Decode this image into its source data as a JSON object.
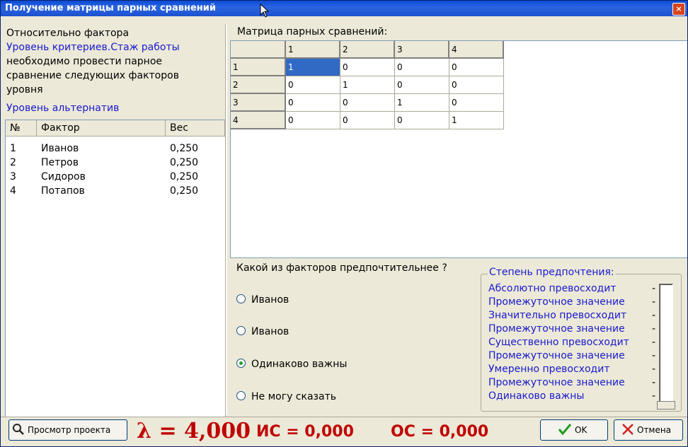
{
  "window": {
    "title": "Получение матрицы парных сравнений",
    "close_icon": "close-icon"
  },
  "left": {
    "relative_label": "Относительно фактора",
    "criteria_line": "Уровень критериев.Стаж работы",
    "instruction_1": "необходимо провести парное",
    "instruction_2": "сравнение следующих факторов",
    "instruction_3": "уровня",
    "alternatives_level": "Уровень альтернатив",
    "columns": [
      "№",
      "Фактор",
      "Вес"
    ],
    "rows": [
      {
        "num": "1",
        "name": "Иванов",
        "weight": "0,250"
      },
      {
        "num": "2",
        "name": "Петров",
        "weight": "0,250"
      },
      {
        "num": "3",
        "name": "Сидоров",
        "weight": "0,250"
      },
      {
        "num": "4",
        "name": "Потапов",
        "weight": "0,250"
      }
    ]
  },
  "matrix": {
    "label": "Матрица парных сравнений:",
    "col_headers": [
      "1",
      "2",
      "3",
      "4"
    ],
    "row_headers": [
      "1",
      "2",
      "3",
      "4"
    ],
    "cells": [
      [
        "1",
        "0",
        "0",
        "0"
      ],
      [
        "0",
        "1",
        "0",
        "0"
      ],
      [
        "0",
        "0",
        "1",
        "0"
      ],
      [
        "0",
        "0",
        "0",
        "1"
      ]
    ],
    "selected_cell": "1,1"
  },
  "question": {
    "text": "Какой из факторов предпочтительнее ?",
    "options": [
      "Иванов",
      "Иванов",
      "Одинаково важны",
      "Не могу сказать"
    ],
    "selected": "Одинаково важны"
  },
  "preference": {
    "title": "Степень предпочтения:",
    "levels": [
      "Абсолютно превосходит",
      "Промежуточное значение",
      "Значительно превосходит",
      "Промежуточное значение",
      "Существенно превосходит",
      "Промежуточное значение",
      "Умеренно превосходит",
      "Промежуточное значение",
      "Одинаково важны"
    ],
    "tick": "-",
    "selected_level": "Одинаково важны"
  },
  "footer": {
    "view_project_label": "Просмотр проекта",
    "lambda_text": "λ = 4,000",
    "ic_text": "ИС = 0,000",
    "oc_text": "ОС = 0,000",
    "ok_label": "OK",
    "cancel_label": "Отмена"
  },
  "colors": {
    "accent_blue": "#1a1acc",
    "metric_red": "#c00000",
    "title_bar": "#0a4bd6",
    "ok_check": "#1f9a1f",
    "cancel_cross": "#d02020"
  }
}
